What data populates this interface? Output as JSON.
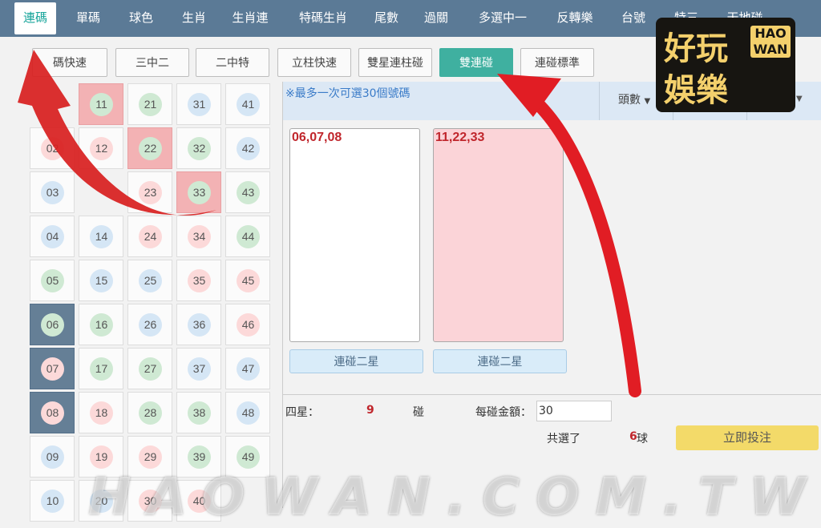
{
  "top_nav": [
    {
      "label": "連碼",
      "active": true
    },
    {
      "label": "單碼"
    },
    {
      "label": "球色"
    },
    {
      "label": "生肖"
    },
    {
      "label": "生肖連"
    },
    {
      "label": "特碼生肖"
    },
    {
      "label": "尾數"
    },
    {
      "label": "過關"
    },
    {
      "label": "多選中一"
    },
    {
      "label": "反轉樂"
    },
    {
      "label": "台號"
    },
    {
      "label": "特三"
    },
    {
      "label": "天地碰"
    }
  ],
  "sub_tabs": [
    {
      "label": "碼快速"
    },
    {
      "label": "三中二"
    },
    {
      "label": "二中特"
    },
    {
      "label": "立柱快速"
    },
    {
      "label": "雙星連柱碰"
    },
    {
      "label": "雙連碰",
      "active": true
    },
    {
      "label": "連碰標準"
    }
  ],
  "number_grid": {
    "cells": [
      {
        "n": "11",
        "c": "green",
        "hl": "pink"
      },
      {
        "n": "21",
        "c": "green"
      },
      {
        "n": "31",
        "c": "blue"
      },
      {
        "n": "41",
        "c": "blue"
      },
      {
        "n": "02",
        "c": "red"
      },
      {
        "n": "12",
        "c": "red"
      },
      {
        "n": "22",
        "c": "green",
        "hl": "pink"
      },
      {
        "n": "32",
        "c": "green"
      },
      {
        "n": "42",
        "c": "blue"
      },
      {
        "n": "03",
        "c": "blue"
      },
      {
        "n": "23",
        "c": "red"
      },
      {
        "n": "33",
        "c": "green",
        "hl": "pink"
      },
      {
        "n": "43",
        "c": "green"
      },
      {
        "n": "04",
        "c": "blue"
      },
      {
        "n": "14",
        "c": "blue"
      },
      {
        "n": "24",
        "c": "red"
      },
      {
        "n": "34",
        "c": "red"
      },
      {
        "n": "44",
        "c": "green"
      },
      {
        "n": "05",
        "c": "green"
      },
      {
        "n": "15",
        "c": "blue"
      },
      {
        "n": "25",
        "c": "blue"
      },
      {
        "n": "35",
        "c": "red"
      },
      {
        "n": "45",
        "c": "red"
      },
      {
        "n": "06",
        "c": "green",
        "hl": "dark"
      },
      {
        "n": "16",
        "c": "green"
      },
      {
        "n": "26",
        "c": "blue"
      },
      {
        "n": "36",
        "c": "blue"
      },
      {
        "n": "46",
        "c": "red"
      },
      {
        "n": "07",
        "c": "red",
        "hl": "dark"
      },
      {
        "n": "17",
        "c": "green"
      },
      {
        "n": "27",
        "c": "green"
      },
      {
        "n": "37",
        "c": "blue"
      },
      {
        "n": "47",
        "c": "blue"
      },
      {
        "n": "08",
        "c": "red",
        "hl": "dark"
      },
      {
        "n": "18",
        "c": "red"
      },
      {
        "n": "28",
        "c": "green"
      },
      {
        "n": "38",
        "c": "green"
      },
      {
        "n": "48",
        "c": "blue"
      },
      {
        "n": "09",
        "c": "blue"
      },
      {
        "n": "19",
        "c": "red"
      },
      {
        "n": "29",
        "c": "red"
      },
      {
        "n": "39",
        "c": "green"
      },
      {
        "n": "49",
        "c": "green"
      },
      {
        "n": "10",
        "c": "blue"
      },
      {
        "n": "20",
        "c": "blue"
      },
      {
        "n": "30",
        "c": "red"
      },
      {
        "n": "40",
        "c": "red"
      }
    ]
  },
  "panel": {
    "hint": "※最多一次可選30個號碼",
    "head_select": "頭數",
    "groups": [
      {
        "title": "06,07,08",
        "button": "連碰二星"
      },
      {
        "title": "11,22,33",
        "button": "連碰二星"
      }
    ],
    "stats": {
      "star_label": "四星：",
      "count": "9",
      "count_unit": "碰",
      "amount_label": "每碰金額：",
      "amount_value": "30",
      "total_label": "共選了",
      "total_count": "6",
      "total_unit": "球",
      "submit_label": "立即投注"
    }
  },
  "logo": {
    "line1": "好玩",
    "line2": "娛樂",
    "badge": "HAO WAN"
  },
  "watermark": "HAOWAN.COM.TW",
  "colors": {
    "nav_bg": "#5b7a96",
    "accent": "#3fb0a0",
    "highlight_pink": "#f3b2b4",
    "selected_dark": "#657f96",
    "arrow_red": "#d81e1e"
  }
}
